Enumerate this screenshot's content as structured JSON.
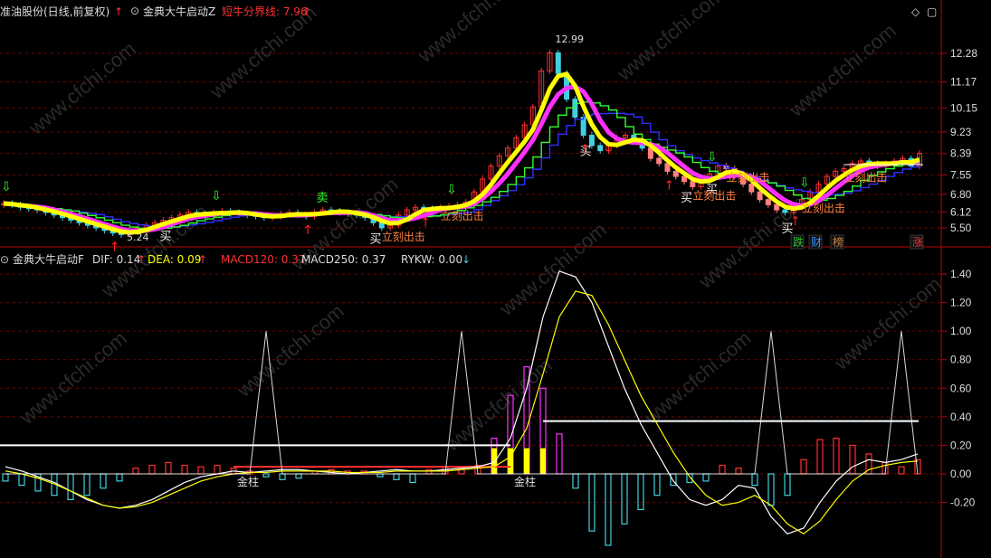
{
  "colors": {
    "bg": "#000000",
    "red": "#ff3030",
    "yellow": "#ffff00",
    "magenta": "#ff30ff",
    "cyan": "#40d0e0",
    "white": "#ffffff",
    "green": "#30ff30",
    "blue": "#3030ff",
    "grid": "#7a0000",
    "axis": "#c00000"
  },
  "top_panel": {
    "stock_name": "准油股份(日线,前复权)",
    "indicator_name": "金典大牛启动Z",
    "boundary_label": "短牛分界线: 7.96",
    "peak_label": "12.99",
    "price_ticks": [
      "12.28",
      "11.17",
      "10.15",
      "9.23",
      "8.39",
      "7.55",
      "6.80",
      "6.12",
      "5.50"
    ],
    "low_label": "5.24",
    "buy_label": "买",
    "sell_label": "卖",
    "strike_label": "立刻出击",
    "badges": [
      {
        "text": "跌",
        "color": "#30c030"
      },
      {
        "text": "财",
        "color": "#3090ff"
      },
      {
        "text": "榜",
        "color": "#d08040"
      },
      {
        "text": "涨",
        "color": "#ff3030"
      }
    ]
  },
  "bottom_panel": {
    "indicator_name": "金典大牛启动F",
    "dif": "DIF: 0.14",
    "dea": "DEA: 0.09",
    "macd120": "MACD120: 0.37",
    "macd250": "MACD250: 0.37",
    "rykw": "RYKW: 0.00",
    "gold_label": "金柱",
    "value_ticks": [
      "1.40",
      "1.20",
      "1.00",
      "0.80",
      "0.60",
      "0.40",
      "0.20",
      "0.00",
      "-0.20"
    ]
  },
  "watermark": "www.cfchi.com",
  "chart_data": [
    {
      "type": "candlestick",
      "title": "金典大牛启动Z",
      "ylim": [
        5.24,
        12.99
      ],
      "y_ticks": [
        12.28,
        11.17,
        10.15,
        9.23,
        8.39,
        7.55,
        6.8,
        6.12,
        5.5
      ],
      "boundary_line": 7.96,
      "annotations": [
        "12.99",
        "5.24",
        "买",
        "卖",
        "立刻出击"
      ],
      "series": [
        {
          "name": "close",
          "color": "#ff3030",
          "values": [
            6.45,
            6.4,
            6.3,
            6.25,
            6.2,
            6.1,
            6.0,
            5.9,
            5.8,
            5.7,
            5.6,
            5.5,
            5.4,
            5.3,
            5.24,
            5.35,
            5.5,
            5.6,
            5.7,
            5.8,
            5.9,
            6.0,
            6.1,
            6.05,
            6.0,
            6.1,
            6.15,
            6.1,
            6.05,
            6.0,
            5.95,
            5.9,
            5.95,
            6.05,
            6.1,
            6.0,
            5.95,
            6.1,
            6.2,
            6.15,
            6.1,
            6.05,
            6.0,
            5.9,
            5.7,
            5.5,
            5.6,
            6.0,
            6.2,
            6.3,
            6.25,
            6.2,
            6.3,
            6.35,
            6.4,
            6.5,
            6.9,
            7.4,
            7.9,
            8.3,
            8.6,
            9.0,
            9.5,
            10.2,
            11.6,
            12.3,
            11.5,
            10.5,
            9.8,
            9.1,
            8.7,
            8.5,
            8.7,
            9.0,
            9.1,
            8.9,
            8.6,
            8.2,
            8.0,
            7.7,
            7.5,
            7.3,
            7.1,
            7.3,
            7.6,
            7.9,
            7.8,
            7.5,
            7.2,
            6.9,
            6.6,
            6.4,
            6.2,
            6.1,
            6.3,
            6.6,
            6.9,
            7.2,
            7.5,
            7.7,
            7.8,
            8.0,
            8.1,
            8.0,
            7.9,
            8.0,
            8.1,
            8.2,
            7.9,
            8.4
          ]
        }
      ]
    },
    {
      "type": "line",
      "title": "金典大牛启动F",
      "ylim": [
        -0.5,
        1.5
      ],
      "y_ticks": [
        1.4,
        1.2,
        1.0,
        0.8,
        0.6,
        0.4,
        0.2,
        0.0,
        -0.2
      ],
      "series": [
        {
          "name": "DIF",
          "color": "#ffffff",
          "values": [
            0.05,
            0.02,
            -0.02,
            -0.06,
            -0.12,
            -0.18,
            -0.22,
            -0.24,
            -0.22,
            -0.18,
            -0.12,
            -0.06,
            -0.02,
            0.0,
            0.02,
            0.01,
            0.02,
            0.03,
            0.03,
            0.02,
            0.01,
            0.0,
            0.01,
            0.02,
            0.03,
            0.02,
            0.02,
            0.03,
            0.04,
            0.05,
            0.08,
            0.25,
            0.6,
            1.1,
            1.42,
            1.38,
            1.2,
            0.9,
            0.6,
            0.35,
            0.15,
            -0.05,
            -0.18,
            -0.22,
            -0.18,
            -0.08,
            -0.1,
            -0.3,
            -0.42,
            -0.38,
            -0.2,
            -0.05,
            0.05,
            0.1,
            0.08,
            0.1,
            0.14
          ]
        },
        {
          "name": "DEA",
          "color": "#ffff00",
          "values": [
            0.02,
            0.0,
            -0.03,
            -0.07,
            -0.12,
            -0.17,
            -0.22,
            -0.24,
            -0.23,
            -0.2,
            -0.15,
            -0.1,
            -0.05,
            -0.02,
            0.0,
            0.01,
            0.01,
            0.02,
            0.02,
            0.02,
            0.02,
            0.01,
            0.01,
            0.01,
            0.02,
            0.02,
            0.02,
            0.02,
            0.03,
            0.04,
            0.05,
            0.12,
            0.32,
            0.7,
            1.1,
            1.28,
            1.25,
            1.05,
            0.8,
            0.55,
            0.35,
            0.15,
            -0.02,
            -0.15,
            -0.22,
            -0.2,
            -0.15,
            -0.22,
            -0.35,
            -0.42,
            -0.33,
            -0.18,
            -0.05,
            0.03,
            0.06,
            0.08,
            0.09
          ]
        },
        {
          "name": "RYKW",
          "color": "#ffffff",
          "values": [
            0,
            0,
            0,
            0,
            0,
            0,
            0,
            0,
            0,
            0,
            0,
            0,
            0,
            0,
            0,
            0,
            1.0,
            0,
            0,
            0,
            0,
            0,
            0,
            0,
            0,
            0,
            0,
            0,
            1.0,
            0,
            0,
            0,
            0,
            0,
            0,
            0,
            0,
            0,
            0,
            0,
            0,
            0,
            0,
            0,
            0,
            0,
            0,
            1.0,
            0,
            0,
            0,
            0,
            0,
            0,
            0,
            1.0,
            0
          ]
        }
      ],
      "bars": {
        "name": "MACD",
        "values": [
          -0.05,
          -0.08,
          -0.12,
          -0.15,
          -0.18,
          -0.15,
          -0.1,
          -0.05,
          0.04,
          0.06,
          0.08,
          0.06,
          0.05,
          0.06,
          0.04,
          0.02,
          -0.02,
          -0.04,
          -0.03,
          0.02,
          0.03,
          0.02,
          0.02,
          -0.02,
          -0.04,
          -0.06,
          0.03,
          0.05,
          0.04,
          0.06,
          0.25,
          0.55,
          0.75,
          0.6,
          0.28,
          -0.1,
          -0.4,
          -0.5,
          -0.35,
          -0.25,
          -0.15,
          -0.08,
          -0.06,
          -0.05,
          0.06,
          0.04,
          -0.08,
          -0.22,
          -0.15,
          0.1,
          0.24,
          0.25,
          0.2,
          0.14,
          0.08,
          0.05,
          0.1
        ]
      },
      "ref_lines": [
        0.37,
        0.2
      ]
    }
  ]
}
